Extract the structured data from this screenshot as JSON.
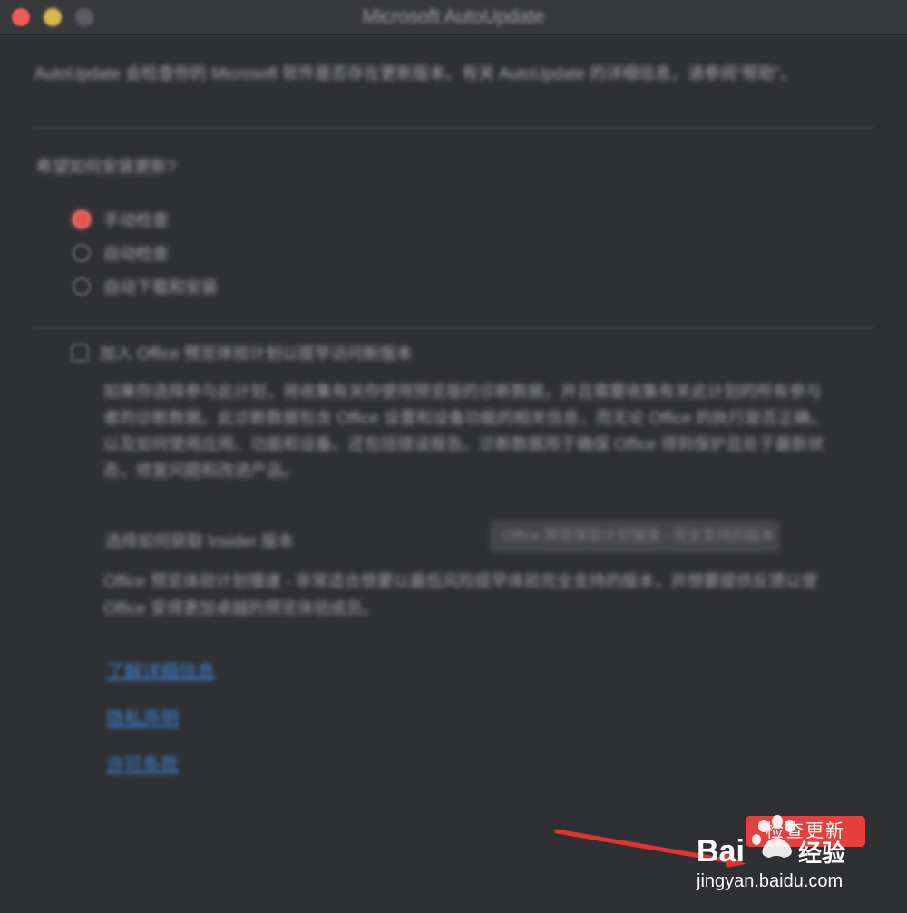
{
  "window": {
    "title": "Microsoft AutoUpdate"
  },
  "intro": {
    "text": "AutoUpdate 会检查你的 Microsoft 软件是否存在更新版本。有关 AutoUpdate 的详细信息，请参阅“帮助”。"
  },
  "install": {
    "question": "希望如何安装更新?",
    "options": [
      {
        "label": "手动检查",
        "selected": true
      },
      {
        "label": "自动检查",
        "selected": false
      },
      {
        "label": "自动下载和安装",
        "selected": false
      }
    ]
  },
  "insider": {
    "checkbox_label": "加入 Office 预览体验计划以提早访问新版本",
    "checked": false,
    "description": "如果你选择参与此计划，将收集有关你使用预览版的诊断数据，并且需要收集有关此计划的所有参与者的诊断数据。此诊断数据包含 Office 设置和设备功能的相关信息，而无论 Office 的执行是否正确，以及如何使用应用、功能和设备。还包括错误报告。诊断数据用于确保 Office 得到保护且处于最新状态，修复问题和改进产品。",
    "channel_label": "选择如何获取 Insider 版本",
    "channel_value": "Office 预览体验计划慢速 - 完全支持的版本",
    "note": "Office 预览体验计划慢速 - 非常适合想要以最低风险提早体验完全支持的版本，并想要提供反馈以使 Office 变得更加卓越的预览体验成员。"
  },
  "links": [
    "了解详细信息",
    "隐私声明",
    "许可条款"
  ],
  "footer": {
    "check_updates_label": "检查更新"
  },
  "watermark": {
    "brand": "Bai",
    "brand_cn": "经验",
    "url": "jingyan.baidu.com"
  },
  "colors": {
    "accent": "#e5403b",
    "link": "#3f82d6",
    "background": "#2f3033"
  }
}
